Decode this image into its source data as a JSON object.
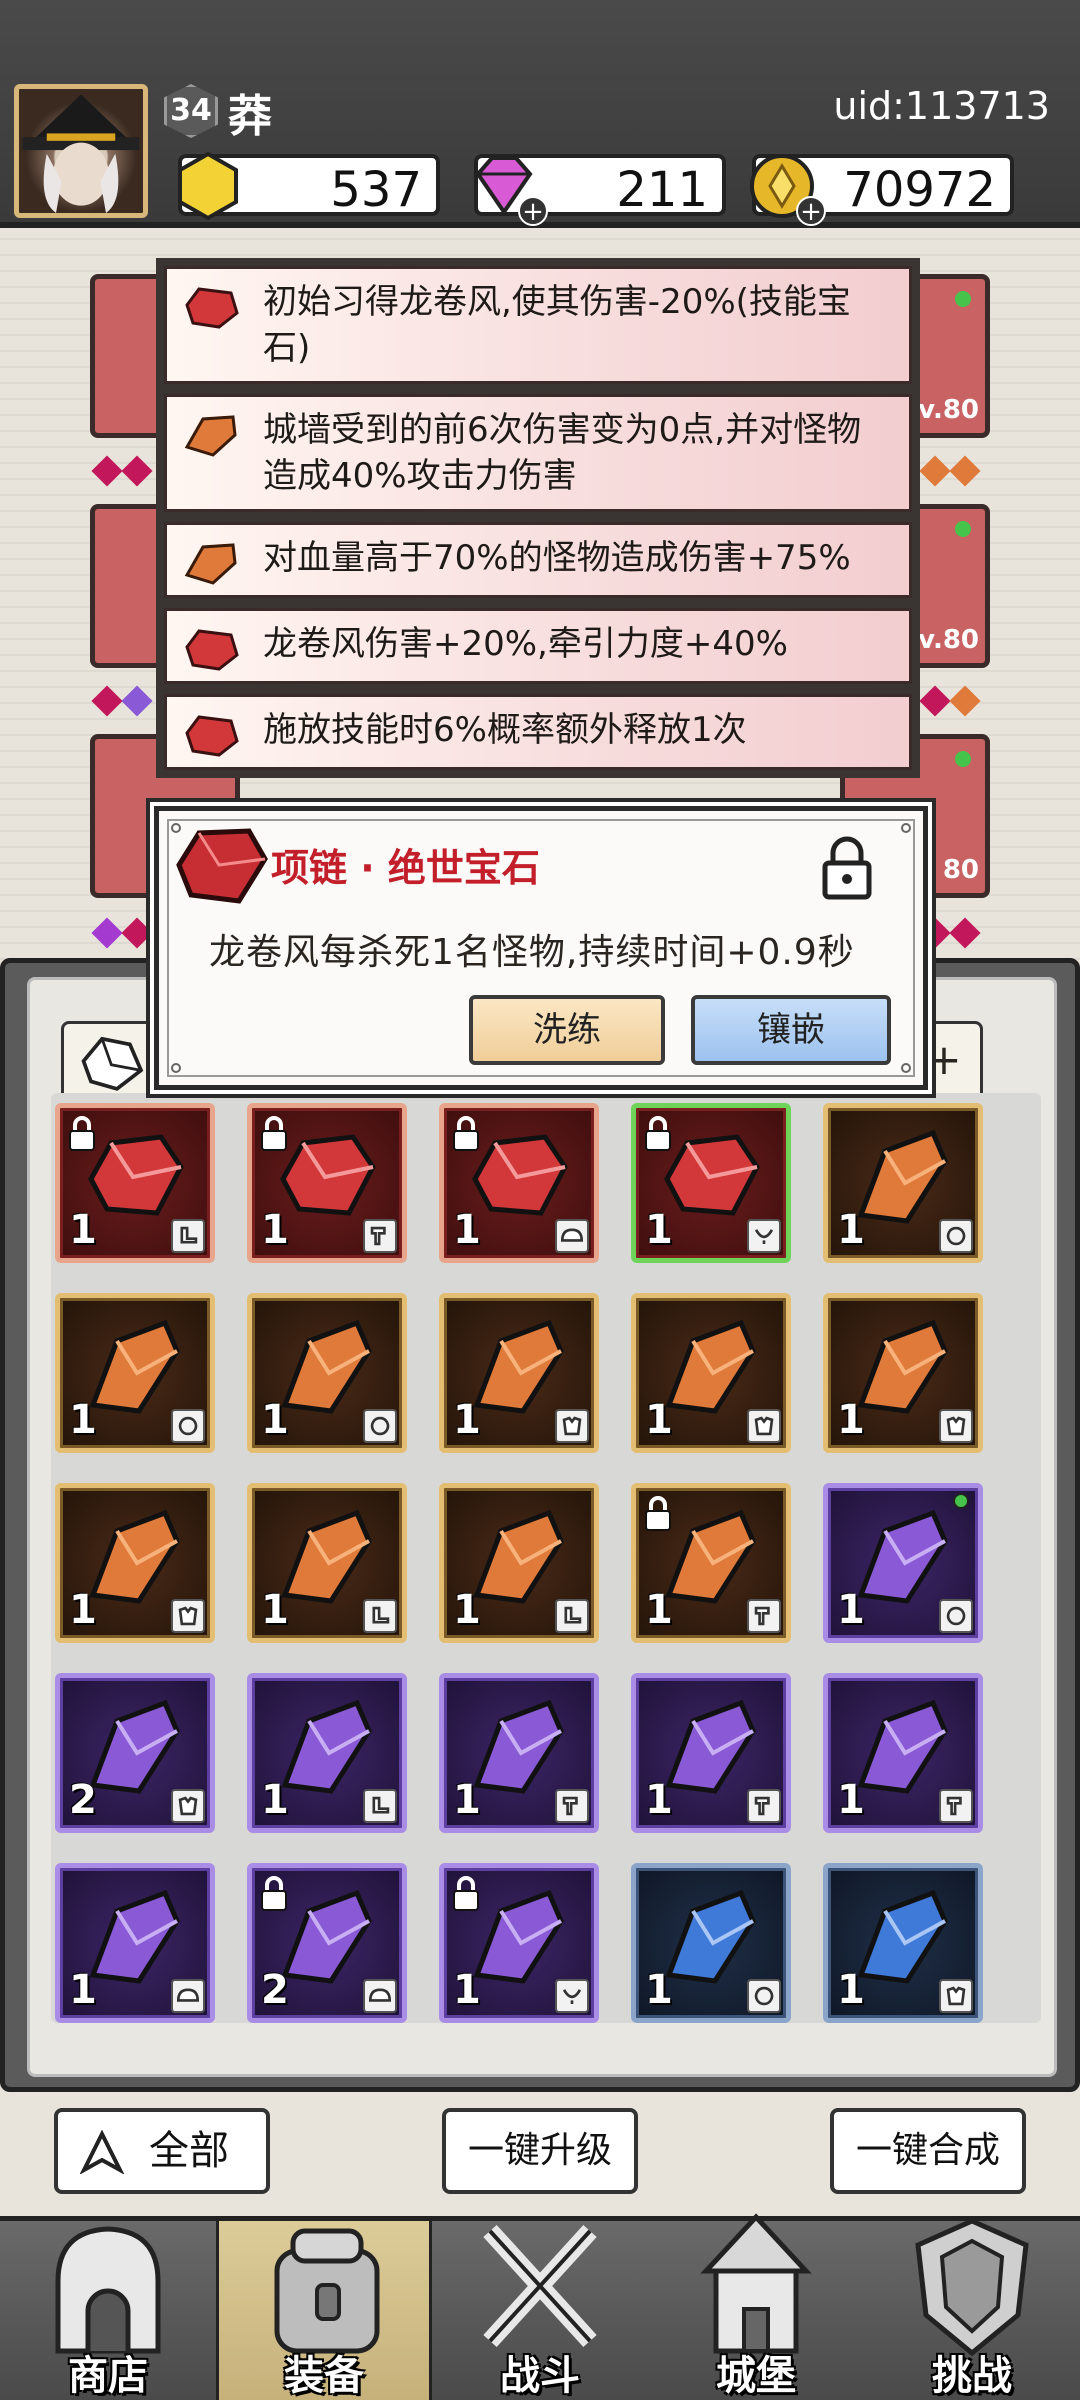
{
  "player": {
    "level": "34",
    "name": "莽",
    "uid": "uid:113713"
  },
  "currencies": {
    "gold": "537",
    "diamond": "211",
    "coin": "70972"
  },
  "background_slots": {
    "lv_labels": [
      "v.80",
      "v.80",
      "80"
    ]
  },
  "skills": [
    "初始习得龙卷风,使其伤害-20%(技能宝石)",
    "城墙受到的前6次伤害变为0点,并对怪物造成40%攻击力伤害",
    "对血量高于70%的怪物造成伤害+75%",
    "龙卷风伤害+20%,牵引力度+40%",
    "施放技能时6%概率额外释放1次"
  ],
  "popup": {
    "title": "项链 · 绝世宝石",
    "description": "龙卷风每杀死1名怪物,持续时间+0.9秒",
    "refine_label": "洗练",
    "inlay_label": "镶嵌"
  },
  "inventory": {
    "filter_right": "+",
    "items": [
      {
        "rarity": "red",
        "count": "1",
        "locked": true,
        "slot": "boots"
      },
      {
        "rarity": "red",
        "count": "1",
        "locked": true,
        "slot": "weapon"
      },
      {
        "rarity": "red",
        "count": "1",
        "locked": true,
        "slot": "hat"
      },
      {
        "rarity": "red",
        "count": "1",
        "locked": true,
        "slot": "necklace",
        "selected": true
      },
      {
        "rarity": "orange",
        "count": "1",
        "slot": "ring"
      },
      {
        "rarity": "orange",
        "count": "1",
        "slot": "ring"
      },
      {
        "rarity": "orange",
        "count": "1",
        "slot": "ring"
      },
      {
        "rarity": "orange",
        "count": "1",
        "slot": "armor"
      },
      {
        "rarity": "orange",
        "count": "1",
        "slot": "armor"
      },
      {
        "rarity": "orange",
        "count": "1",
        "slot": "armor"
      },
      {
        "rarity": "orange",
        "count": "1",
        "slot": "armor"
      },
      {
        "rarity": "orange",
        "count": "1",
        "slot": "boots"
      },
      {
        "rarity": "orange",
        "count": "1",
        "slot": "boots"
      },
      {
        "rarity": "orange",
        "count": "1",
        "locked": true,
        "slot": "weapon"
      },
      {
        "rarity": "purple",
        "count": "1",
        "slot": "ring",
        "new": true
      },
      {
        "rarity": "purple",
        "count": "2",
        "slot": "armor"
      },
      {
        "rarity": "purple",
        "count": "1",
        "slot": "boots"
      },
      {
        "rarity": "purple",
        "count": "1",
        "slot": "weapon"
      },
      {
        "rarity": "purple",
        "count": "1",
        "slot": "weapon"
      },
      {
        "rarity": "purple",
        "count": "1",
        "slot": "weapon"
      },
      {
        "rarity": "purple",
        "count": "1",
        "slot": "hat"
      },
      {
        "rarity": "purple",
        "count": "2",
        "locked": true,
        "slot": "hat"
      },
      {
        "rarity": "purple",
        "count": "1",
        "locked": true,
        "slot": "necklace"
      },
      {
        "rarity": "blue",
        "count": "1",
        "slot": "ring"
      },
      {
        "rarity": "blue",
        "count": "1",
        "slot": "armor"
      }
    ]
  },
  "actions": {
    "all_label": "全部",
    "upgrade_label": "一键升级",
    "merge_label": "一键合成"
  },
  "nav": [
    {
      "label": "商店",
      "icon": "shop-icon"
    },
    {
      "label": "装备",
      "icon": "equipment-bag-icon"
    },
    {
      "label": "战斗",
      "icon": "crossed-swords-icon"
    },
    {
      "label": "城堡",
      "icon": "castle-icon"
    },
    {
      "label": "挑战",
      "icon": "challenge-shield-icon"
    }
  ],
  "colors": {
    "red_gem": "#d2383a",
    "orange_gem": "#e07a3a",
    "purple_gem": "#8a5ad6",
    "blue_gem": "#3f7ad8",
    "popup_title": "#c21f2b"
  }
}
